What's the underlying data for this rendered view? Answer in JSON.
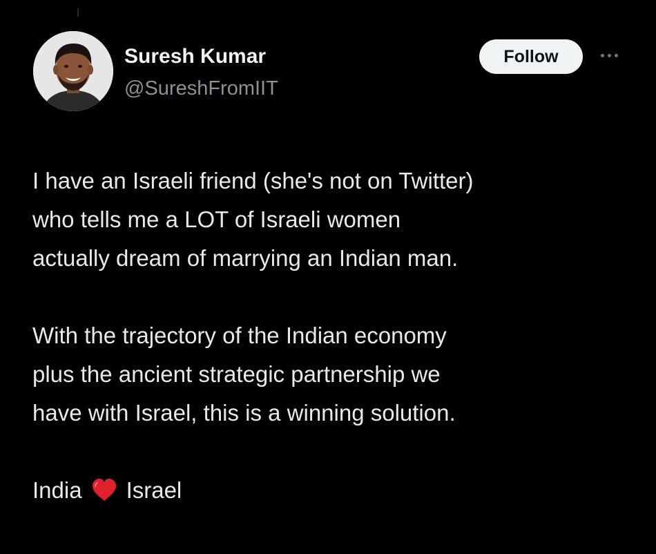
{
  "tweet": {
    "author_name": "Suresh Kumar",
    "author_handle": "@SureshFromIIT",
    "follow_label": "Follow",
    "paragraph1": [
      "I have an Israeli friend (she's not on Twitter)",
      "who tells me a LOT of Israeli women",
      "actually dream of marrying an Indian man."
    ],
    "paragraph2": [
      "With the trajectory of the Indian economy",
      "plus the ancient strategic partnership we",
      "have with Israel, this is a winning solution."
    ],
    "closing_left": "India",
    "closing_right": "Israel",
    "closing_icon": "red-heart-emoji"
  },
  "colors": {
    "background": "#000000",
    "text": "#e7e9ea",
    "handle": "#8b9197",
    "follow_bg": "#eff3f4",
    "heart": "#e0202b"
  }
}
